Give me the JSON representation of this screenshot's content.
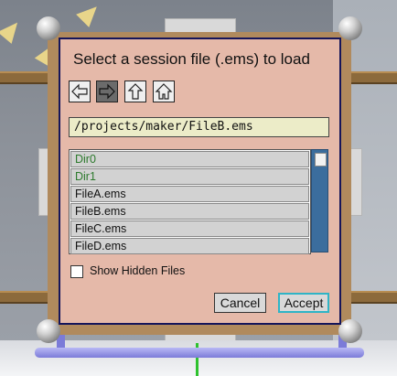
{
  "dialog": {
    "title": "Select a session file (.ems) to load",
    "nav": [
      {
        "name": "back-button",
        "icon": "arrow-left-icon"
      },
      {
        "name": "forward-button",
        "icon": "arrow-right-icon"
      },
      {
        "name": "up-button",
        "icon": "arrow-up-icon"
      },
      {
        "name": "home-button",
        "icon": "home-icon"
      }
    ],
    "path": "/projects/maker/FileB.ems",
    "files": [
      {
        "label": "Dir0",
        "type": "dir"
      },
      {
        "label": "Dir1",
        "type": "dir"
      },
      {
        "label": "FileA.ems",
        "type": "file"
      },
      {
        "label": "FileB.ems",
        "type": "file"
      },
      {
        "label": "FileC.ems",
        "type": "file"
      },
      {
        "label": "FileD.ems",
        "type": "file"
      }
    ],
    "show_hidden_label": "Show Hidden Files",
    "show_hidden_checked": false,
    "cancel_label": "Cancel",
    "accept_label": "Accept"
  },
  "colors": {
    "dialog_bg": "#e5b9a9",
    "dir_text": "#2d7a2d",
    "scrollbar": "#3b6d9d",
    "accept_border": "#2fb4c6"
  }
}
